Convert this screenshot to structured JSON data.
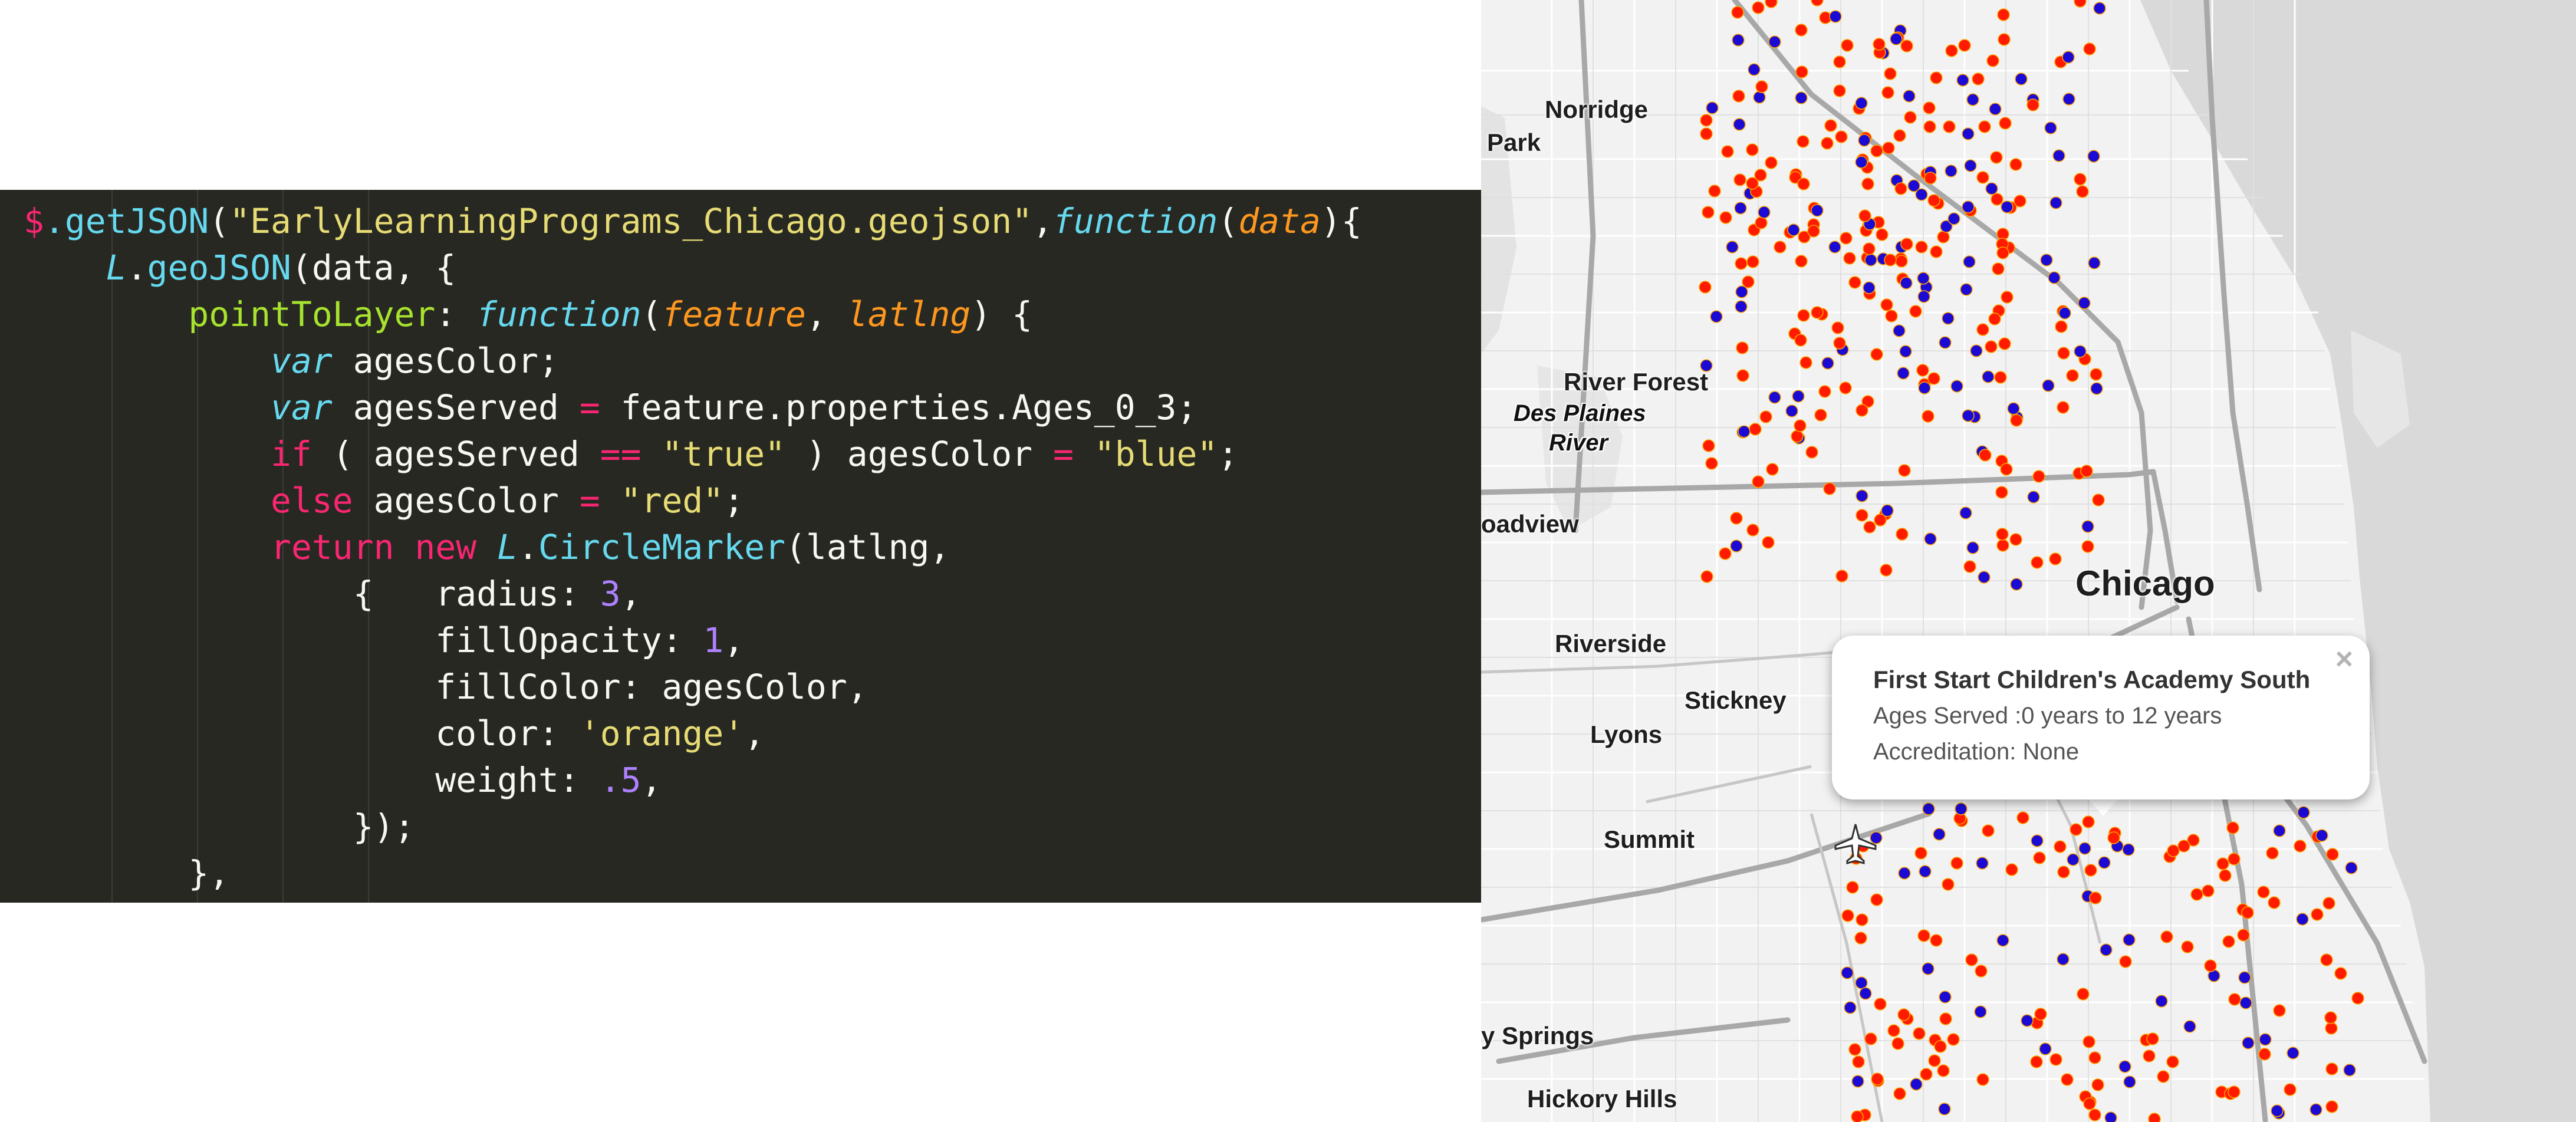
{
  "code": {
    "lines": [
      [
        [
          "kw",
          "$"
        ],
        [
          "fn",
          ".getJSON"
        ],
        [
          "t",
          "("
        ],
        [
          "st",
          "\"EarlyLearningPrograms_Chicago.geojson\""
        ],
        [
          "t",
          ","
        ],
        [
          "sa",
          "function"
        ],
        [
          "t",
          "("
        ],
        [
          "ar",
          "data"
        ],
        [
          "t",
          "){"
        ]
      ],
      [
        [
          "t",
          "    "
        ],
        [
          "sa",
          "L"
        ],
        [
          "t",
          "."
        ],
        [
          "fn",
          "geoJSON"
        ],
        [
          "t",
          "(data, {"
        ]
      ],
      [
        [
          "t",
          "        "
        ],
        [
          "pr",
          "pointToLayer"
        ],
        [
          "t",
          ": "
        ],
        [
          "sa",
          "function"
        ],
        [
          "t",
          "("
        ],
        [
          "ar",
          "feature"
        ],
        [
          "t",
          ", "
        ],
        [
          "ar",
          "latlng"
        ],
        [
          "t",
          ") {"
        ]
      ],
      [
        [
          "t",
          "            "
        ],
        [
          "sa",
          "var"
        ],
        [
          "t",
          " agesColor;"
        ]
      ],
      [
        [
          "t",
          "            "
        ],
        [
          "sa",
          "var"
        ],
        [
          "t",
          " agesServed "
        ],
        [
          "kw",
          "="
        ],
        [
          "t",
          " feature.properties.Ages_0_3;"
        ]
      ],
      [
        [
          "t",
          "            "
        ],
        [
          "kw",
          "if"
        ],
        [
          "t",
          " ( agesServed "
        ],
        [
          "kw",
          "=="
        ],
        [
          "t",
          " "
        ],
        [
          "st",
          "\"true\""
        ],
        [
          "t",
          " ) agesColor "
        ],
        [
          "kw",
          "="
        ],
        [
          "t",
          " "
        ],
        [
          "st",
          "\"blue\""
        ],
        [
          "t",
          ";"
        ]
      ],
      [
        [
          "t",
          "            "
        ],
        [
          "kw",
          "else"
        ],
        [
          "t",
          " agesColor "
        ],
        [
          "kw",
          "="
        ],
        [
          "t",
          " "
        ],
        [
          "st",
          "\"red\""
        ],
        [
          "t",
          ";"
        ]
      ],
      [
        [
          "t",
          "            "
        ],
        [
          "kw",
          "return"
        ],
        [
          "t",
          " "
        ],
        [
          "kw",
          "new"
        ],
        [
          "t",
          " "
        ],
        [
          "sa",
          "L"
        ],
        [
          "t",
          "."
        ],
        [
          "fn",
          "CircleMarker"
        ],
        [
          "t",
          "(latlng,"
        ]
      ],
      [
        [
          "t",
          "                {   radius: "
        ],
        [
          "nu",
          "3"
        ],
        [
          "t",
          ","
        ]
      ],
      [
        [
          "t",
          "                    fillOpacity: "
        ],
        [
          "nu",
          "1"
        ],
        [
          "t",
          ","
        ]
      ],
      [
        [
          "t",
          "                    fillColor: agesColor,"
        ]
      ],
      [
        [
          "t",
          "                    color: "
        ],
        [
          "st",
          "'orange'"
        ],
        [
          "t",
          ","
        ]
      ],
      [
        [
          "t",
          "                    weight: "
        ],
        [
          "nu",
          ".5"
        ],
        [
          "t",
          ","
        ]
      ],
      [
        [
          "t",
          "                });"
        ]
      ],
      [
        [
          "t",
          "        },"
        ]
      ]
    ]
  },
  "map": {
    "labels": {
      "norridge": "Norridge",
      "park": "Park",
      "river_forest": "River Forest",
      "des_plaines_1": "Des Plaines",
      "des_plaines_2": "River",
      "broadview": "oadview",
      "chicago": "Chicago",
      "riverside": "Riverside",
      "stickney": "Stickney",
      "lyons": "Lyons",
      "summit": "Summit",
      "springs": "y Springs",
      "hickory_hills": "Hickory Hills"
    },
    "marker_colors": {
      "red": "#ff1a00",
      "blue": "#1a0ad4",
      "outline": "#ffa500"
    },
    "popup": {
      "title": "First Start Children's Academy South",
      "ages": "Ages Served :0 years to 12 years",
      "accreditation": "Accreditation: None",
      "close": "×"
    },
    "airport_icon": "airplane-icon"
  }
}
